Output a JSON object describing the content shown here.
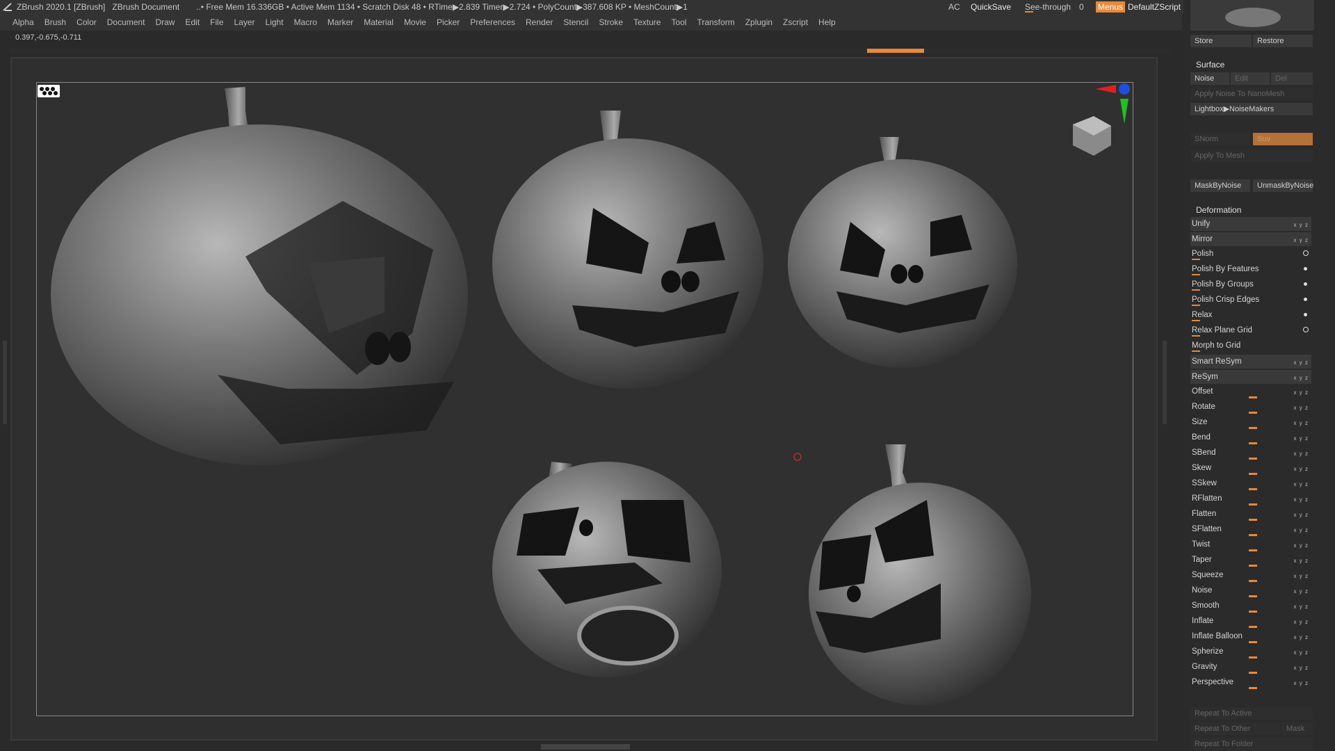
{
  "titlebar": {
    "app": "ZBrush 2020.1 [ZBrush]",
    "doc": "ZBrush Document",
    "stats": "..• Free Mem 16.336GB • Active Mem 1134 • Scratch Disk 48 •  RTime▶2.839 Timer▶2.724 • PolyCount▶387.608 KP • MeshCount▶1",
    "ac": "AC",
    "quicksave": "QuickSave",
    "seethrough_label": "See-through",
    "seethrough_value": "0",
    "menus": "Menus",
    "zscript": "DefaultZScript"
  },
  "menu": [
    "Alpha",
    "Brush",
    "Color",
    "Document",
    "Draw",
    "Edit",
    "File",
    "Layer",
    "Light",
    "Macro",
    "Marker",
    "Material",
    "Movie",
    "Picker",
    "Preferences",
    "Render",
    "Stencil",
    "Stroke",
    "Texture",
    "Tool",
    "Transform",
    "Zplugin",
    "Zscript",
    "Help"
  ],
  "coords": "0.397,-0.675,-0.711",
  "panel": {
    "store": "Store",
    "restore": "Restore",
    "surface": {
      "title": "Surface",
      "noise": "Noise",
      "edit": "Edit",
      "del": "Del",
      "apply_nano": "Apply Noise To NanoMesh",
      "lightbox": "Lightbox▶NoiseMakers",
      "snorm": "SNorm",
      "suv": "Suv",
      "apply_mesh": "Apply To Mesh",
      "maskbynoise": "MaskByNoise",
      "unmaskbynoise": "UnmaskByNoise"
    },
    "deformation": {
      "title": "Deformation",
      "items": [
        "Unify",
        "Mirror",
        "Polish",
        "Polish By Features",
        "Polish By Groups",
        "Polish Crisp Edges",
        "Relax",
        "Relax Plane Grid",
        "Morph to Grid",
        "Smart ReSym",
        "ReSym",
        "Offset",
        "Rotate",
        "Size",
        "Bend",
        "SBend",
        "Skew",
        "SSkew",
        "RFlatten",
        "Flatten",
        "SFlatten",
        "Twist",
        "Taper",
        "Squeeze",
        "Noise",
        "Smooth",
        "Inflate",
        "Inflate Balloon",
        "Spherize",
        "Gravity",
        "Perspective"
      ]
    },
    "repeat_active": "Repeat To Active",
    "repeat_other": "Repeat To Other",
    "mask": "Mask",
    "repeat_folder": "Repeat To Folder"
  }
}
